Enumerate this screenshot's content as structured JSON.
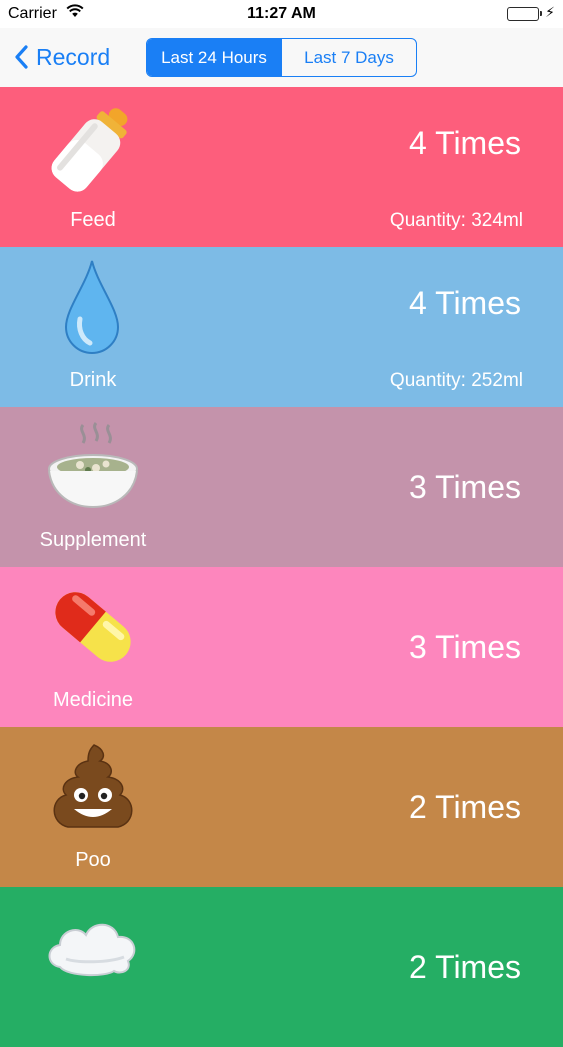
{
  "status_bar": {
    "carrier": "Carrier",
    "time": "11:27 AM",
    "battery_color": "#4cd964"
  },
  "nav": {
    "back_label": "Record",
    "segments": [
      {
        "label": "Last 24 Hours",
        "selected": true
      },
      {
        "label": "Last 7 Days",
        "selected": false
      }
    ],
    "accent_color": "#1a7ff5"
  },
  "rows": [
    {
      "label": "Feed",
      "count": "4 Times",
      "quantity": "Quantity: 324ml",
      "color": "#fd5e7c",
      "icon": "baby-bottle-icon"
    },
    {
      "label": "Drink",
      "count": "4 Times",
      "quantity": "Quantity: 252ml",
      "color": "#7dbbe6",
      "icon": "water-drop-icon"
    },
    {
      "label": "Supplement",
      "count": "3 Times",
      "quantity": "",
      "color": "#c493ab",
      "icon": "soup-bowl-icon"
    },
    {
      "label": "Medicine",
      "count": "3 Times",
      "quantity": "",
      "color": "#fd86bd",
      "icon": "pill-icon"
    },
    {
      "label": "Poo",
      "count": "2 Times",
      "quantity": "",
      "color": "#c48748",
      "icon": "poo-icon"
    },
    {
      "label": "",
      "count": "2 Times",
      "quantity": "",
      "color": "#25ae64",
      "icon": "cloud-icon"
    }
  ]
}
